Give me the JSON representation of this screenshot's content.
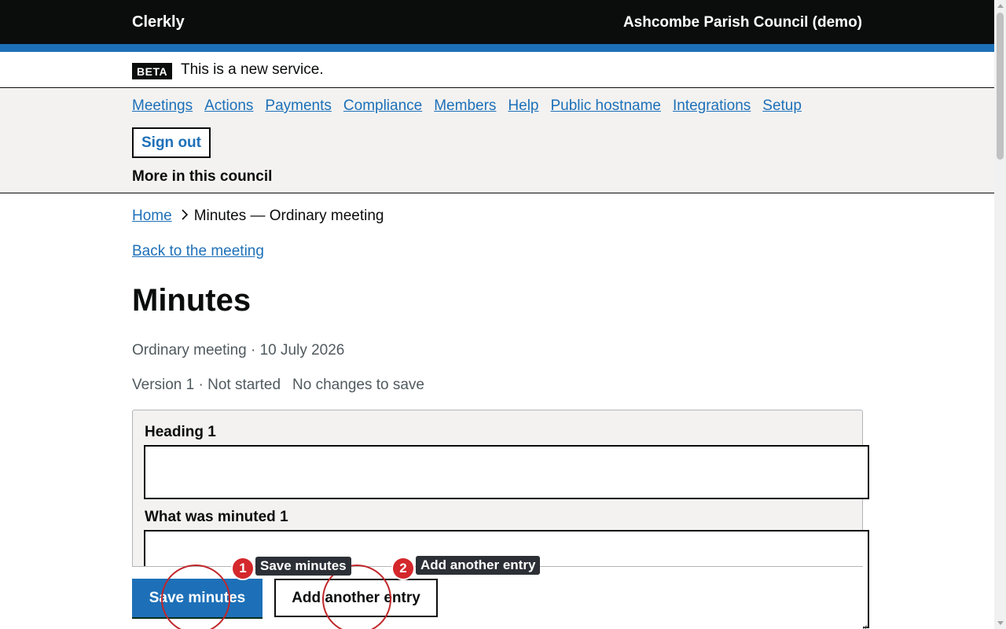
{
  "header": {
    "brand": "Clerkly",
    "council": "Ashcombe Parish Council (demo)"
  },
  "phase_banner": {
    "tag": "BETA",
    "text": "This is a new service."
  },
  "nav": {
    "links": [
      "Meetings",
      "Actions",
      "Payments",
      "Compliance",
      "Members",
      "Help",
      "Public hostname",
      "Integrations",
      "Setup"
    ],
    "sign_out": "Sign out",
    "more_label": "More in this council"
  },
  "breadcrumb": {
    "home": "Home",
    "current": "Minutes — Ordinary meeting"
  },
  "back_link": "Back to the meeting",
  "page": {
    "title": "Minutes",
    "meeting_info": "Ordinary meeting · 10 July 2026",
    "version_status": "Version 1 · Not started",
    "save_state": "No changes to save"
  },
  "entry": {
    "heading_label": "Heading 1",
    "heading_value": "",
    "minuted_label": "What was minuted 1",
    "minuted_value": ""
  },
  "actions": {
    "save": "Save minutes",
    "add": "Add another entry"
  },
  "annotations": [
    {
      "number": "1",
      "label": "Save minutes"
    },
    {
      "number": "2",
      "label": "Add another entry"
    }
  ],
  "colors": {
    "header_bg": "#0b0c0c",
    "accent_blue": "#1d70b8",
    "nav_bg": "#f3f2f1",
    "annotation_red": "#d4282c"
  }
}
